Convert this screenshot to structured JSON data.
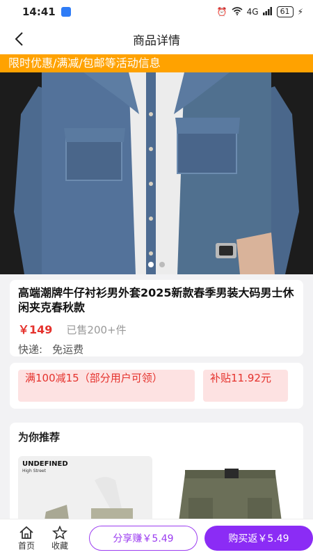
{
  "status": {
    "time": "14:41",
    "battery": "61",
    "network": "4G"
  },
  "nav": {
    "title": "商品详情"
  },
  "promo": {
    "text": "限时优惠/满减/包邮等活动信息"
  },
  "carousel": {
    "total": 2,
    "active": 1
  },
  "product": {
    "title": "高端潮牌牛仔衬衫男外套2025新款春季男装大码男士休闲夹克春秋款",
    "price": "￥149",
    "sold": "已售200+件",
    "shipping_label": "快递:",
    "shipping_value": "免运费"
  },
  "coupons": [
    {
      "text": "满100减15（部分用户可领）"
    },
    {
      "text": "补贴11.92元"
    }
  ],
  "recommend": {
    "title": "为你推荐",
    "items": [
      {
        "brand": "UNDEFINED",
        "brand_sub": "High Street"
      },
      {
        "brand": "",
        "brand_sub": ""
      }
    ]
  },
  "bottom": {
    "home_label": "首页",
    "fav_label": "收藏",
    "share_label": "分享赚￥5.49",
    "buy_label": "购买返￥5.49"
  },
  "colors": {
    "accent": "#8b2cf5",
    "price": "#e5322d",
    "banner": "#ffa200"
  }
}
